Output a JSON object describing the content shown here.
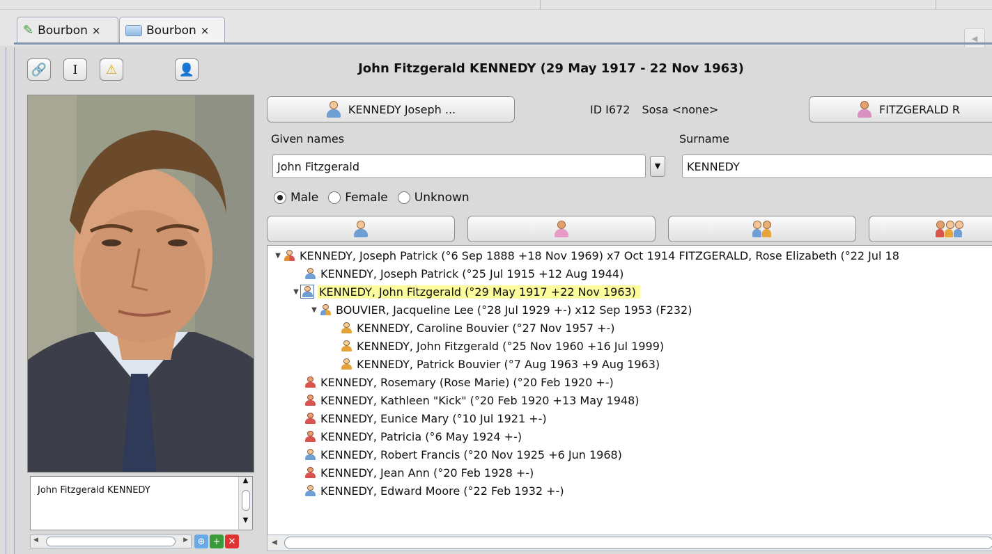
{
  "tabs": [
    {
      "label": "Bourbon",
      "icon": "pencil-icon",
      "close": "×"
    },
    {
      "label": "Bourbon",
      "icon": "window-icon",
      "close": "×"
    }
  ],
  "toolbar": {
    "link_icon": "link-icon",
    "cursor_icon": "text-cursor-icon",
    "warning_icon": "warning-icon",
    "add_person_icon": "add-person-icon"
  },
  "individual": {
    "title": "John Fitzgerald KENNEDY (29 May 1917 - 22 Nov 1963)",
    "father_button": "KENNEDY Joseph ...",
    "mother_button": "FITZGERALD R",
    "id_text": "ID I672",
    "sosa_text": "Sosa <none>",
    "given_names_label": "Given names",
    "given_names_value": "John Fitzgerald",
    "surname_label": "Surname",
    "surname_value": "KENNEDY",
    "sex_options": [
      "Male",
      "Female",
      "Unknown"
    ],
    "sex_selected": "Male",
    "photo_caption": "John Fitzgerald KENNEDY"
  },
  "tree": [
    {
      "text": "KENNEDY, Joseph Patrick (°6 Sep 1888 +18 Nov 1969) x7 Oct 1914 FITZGERALD, Rose Elizabeth (°22 Jul 18",
      "icon": "family-icon"
    },
    {
      "text": "KENNEDY, Joseph Patrick (°25 Jul 1915 +12 Aug 1944)",
      "icon": "male-icon"
    },
    {
      "text": "KENNEDY, John Fitzgerald (°29 May 1917 +22 Nov 1963)",
      "icon": "male-selected-icon"
    },
    {
      "text": "BOUVIER, Jacqueline Lee (°28 Jul 1929 +-) x12 Sep 1953 (F232)",
      "icon": "couple-icon"
    },
    {
      "text": "KENNEDY, Caroline Bouvier (°27 Nov 1957 +-)",
      "icon": "child-female-icon"
    },
    {
      "text": "KENNEDY, John Fitzgerald (°25 Nov 1960 +16 Jul 1999)",
      "icon": "child-male-icon"
    },
    {
      "text": "KENNEDY, Patrick Bouvier (°7 Aug 1963 +9 Aug 1963)",
      "icon": "child-male-icon"
    },
    {
      "text": "KENNEDY, Rosemary (Rose Marie) (°20 Feb 1920 +-)",
      "icon": "female-icon"
    },
    {
      "text": "KENNEDY, Kathleen \"Kick\" (°20 Feb 1920 +13 May 1948)",
      "icon": "female-icon"
    },
    {
      "text": "KENNEDY, Eunice Mary (°10 Jul 1921 +-)",
      "icon": "female-icon"
    },
    {
      "text": "KENNEDY, Patricia (°6 May 1924 +-)",
      "icon": "female-icon"
    },
    {
      "text": "KENNEDY, Robert Francis (°20 Nov 1925 +6 Jun 1968)",
      "icon": "male-icon"
    },
    {
      "text": "KENNEDY, Jean Ann (°20 Feb 1928 +-)",
      "icon": "female-icon"
    },
    {
      "text": "KENNEDY, Edward Moore (°22 Feb 1932 +-)",
      "icon": "male-icon"
    }
  ],
  "colors": {
    "highlight": "#fbfb9e",
    "tab_border": "#7f93ad"
  }
}
